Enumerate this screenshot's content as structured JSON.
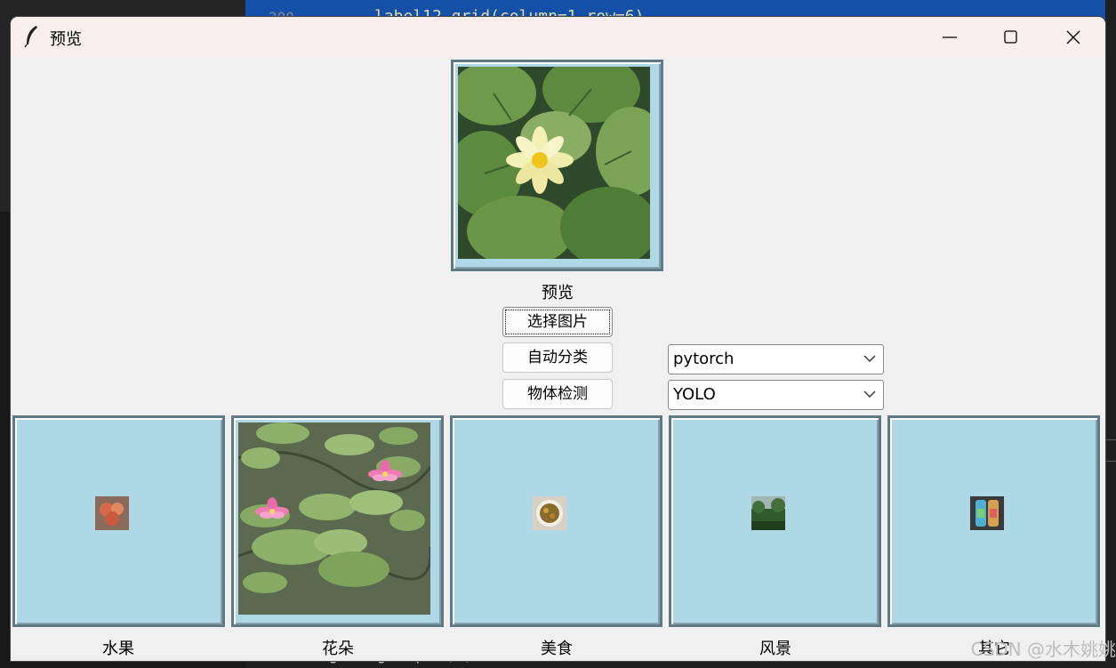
{
  "background": {
    "line_number": "200",
    "code_line_top": "label12.grid(column=1,row=6)",
    "code_line_bottom": "img=Image.open(f)"
  },
  "window": {
    "title": "预览",
    "title_icon": "feather-icon",
    "controls": [
      "minimize-icon",
      "maximize-icon",
      "close-icon"
    ]
  },
  "preview": {
    "label": "预览"
  },
  "buttons": {
    "select_image": "选择图片",
    "auto_classify": "自动分类",
    "object_detect": "物体检测"
  },
  "dropdowns": {
    "framework": {
      "selected": "pytorch"
    },
    "detector": {
      "selected": "YOLO"
    }
  },
  "categories": [
    {
      "label": "水果"
    },
    {
      "label": "花朵"
    },
    {
      "label": "美食"
    },
    {
      "label": "风景"
    },
    {
      "label": "其它"
    }
  ],
  "watermark": "CSDN @水木姚姚",
  "colors": {
    "frame_fill": "#aed8e6",
    "frame_border": "#5d7a85",
    "window_bg": "#f0f0f0",
    "titlebar_bg": "#f8eeee"
  }
}
